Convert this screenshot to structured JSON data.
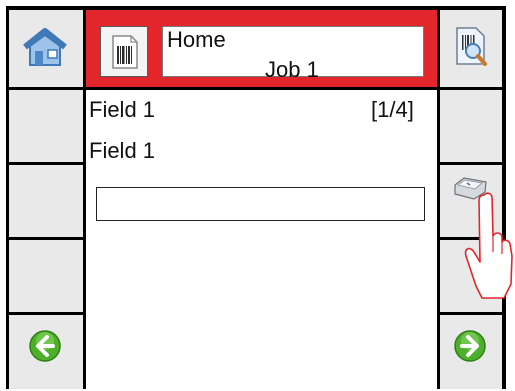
{
  "header": {
    "title": "Home",
    "subtitle": "Job 1",
    "background_color": "#e3262b"
  },
  "field": {
    "name": "Field 1",
    "position": "[1/4]",
    "value": "Field 1",
    "input_value": ""
  },
  "icons": {
    "top_left": "home-icon",
    "header": "barcode-job-icon",
    "top_right": "preview-icon",
    "right_middle": "keyboard-key-icon",
    "overlay": "pointing-hand-icon",
    "bottom_left": "back-arrow-icon",
    "bottom_right": "next-arrow-icon"
  },
  "colors": {
    "button_face": "#e9e9e9",
    "arrow_green": "#4cb028",
    "hand_outline": "#e3262b"
  }
}
